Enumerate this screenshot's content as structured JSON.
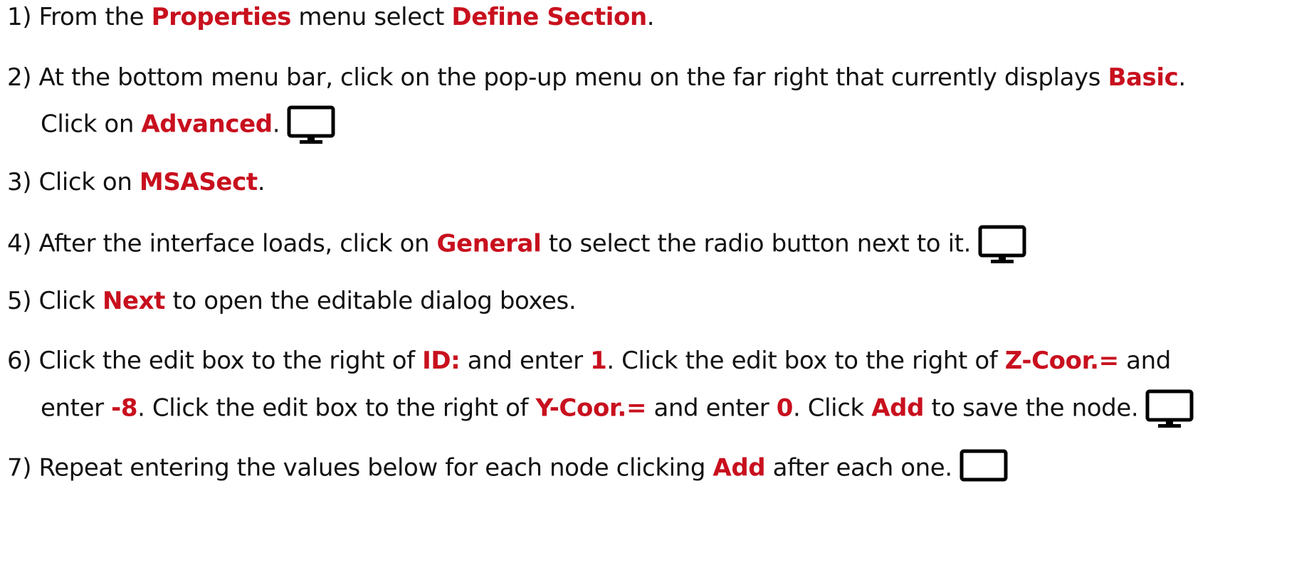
{
  "steps": [
    {
      "id": "step-1",
      "lines": [
        [
          {
            "t": "1) From the ",
            "hl": false
          },
          {
            "t": "Properties",
            "hl": true
          },
          {
            "t": " menu select ",
            "hl": false
          },
          {
            "t": "Define Section",
            "hl": true
          },
          {
            "t": ".",
            "hl": false
          }
        ]
      ]
    },
    {
      "id": "step-2",
      "lines": [
        [
          {
            "t": "2) At the bottom menu bar, click on the pop-up menu on the far right that currently displays ",
            "hl": false
          },
          {
            "t": "Basic",
            "hl": true
          },
          {
            "t": ".",
            "hl": false
          }
        ],
        [
          {
            "t": "Click on ",
            "hl": false
          },
          {
            "t": "Advanced",
            "hl": true
          },
          {
            "t": ".",
            "hl": false
          },
          {
            "icon": "monitor-icon"
          }
        ]
      ]
    },
    {
      "id": "step-3",
      "lines": [
        [
          {
            "t": "3) Click on ",
            "hl": false
          },
          {
            "t": "MSASect",
            "hl": true
          },
          {
            "t": ".",
            "hl": false
          }
        ]
      ]
    },
    {
      "id": "step-4",
      "lines": [
        [
          {
            "t": "4) After the interface loads, click on ",
            "hl": false
          },
          {
            "t": "General",
            "hl": true
          },
          {
            "t": " to select the radio button next to it.",
            "hl": false
          },
          {
            "icon": "monitor-icon"
          }
        ]
      ]
    },
    {
      "id": "step-5",
      "lines": [
        [
          {
            "t": "5) Click ",
            "hl": false
          },
          {
            "t": "Next",
            "hl": true
          },
          {
            "t": " to open the editable dialog boxes.",
            "hl": false
          }
        ]
      ]
    },
    {
      "id": "step-6",
      "lines": [
        [
          {
            "t": "6) Click the edit box to the right of ",
            "hl": false
          },
          {
            "t": "ID:",
            "hl": true
          },
          {
            "t": " and enter ",
            "hl": false
          },
          {
            "t": "1",
            "hl": true
          },
          {
            "t": ". Click the edit box to the right of ",
            "hl": false
          },
          {
            "t": "Z-Coor.=",
            "hl": true
          },
          {
            "t": " and",
            "hl": false
          }
        ],
        [
          {
            "t": "enter ",
            "hl": false
          },
          {
            "t": "-8",
            "hl": true
          },
          {
            "t": ". Click the edit box to the right of ",
            "hl": false
          },
          {
            "t": "Y-Coor.=",
            "hl": true
          },
          {
            "t": " and enter ",
            "hl": false
          },
          {
            "t": "0",
            "hl": true
          },
          {
            "t": ". Click ",
            "hl": false
          },
          {
            "t": "Add",
            "hl": true
          },
          {
            "t": " to save the node.",
            "hl": false
          },
          {
            "icon": "monitor-icon"
          }
        ]
      ]
    },
    {
      "id": "step-7",
      "lines": [
        [
          {
            "t": "7) Repeat entering the values below for each node clicking ",
            "hl": false
          },
          {
            "t": "Add",
            "hl": true
          },
          {
            "t": " after each one.",
            "hl": false
          },
          {
            "icon": "monitor-icon"
          }
        ]
      ]
    }
  ],
  "colors": {
    "text": "#111111",
    "highlight": "#c8101e"
  }
}
